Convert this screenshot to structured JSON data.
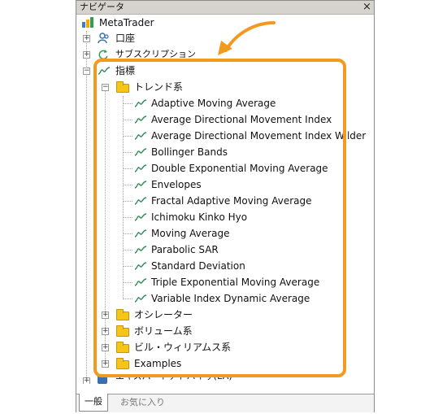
{
  "window": {
    "title": "ナビゲータ",
    "close_label": "×"
  },
  "tree": {
    "root": "MetaTrader",
    "account": "口座",
    "subscription": "サブスクリプション",
    "indicators": {
      "label": "指標",
      "trend": {
        "label": "トレンド系",
        "items": [
          "Adaptive Moving Average",
          "Average Directional Movement Index",
          "Average Directional Movement Index Wilder",
          "Bollinger Bands",
          "Double Exponential Moving Average",
          "Envelopes",
          "Fractal Adaptive Moving Average",
          "Ichimoku Kinko Hyo",
          "Moving Average",
          "Parabolic SAR",
          "Standard Deviation",
          "Triple Exponential Moving Average",
          "Variable Index Dynamic Average"
        ]
      },
      "folders": [
        "オシレーター",
        "ボリューム系",
        "ビル・ウィリアムス系",
        "Examples"
      ]
    },
    "experts": "エキスパートアドバイザ(EA)"
  },
  "tabs": {
    "general": "一般",
    "favorites": "お気に入り"
  },
  "colors": {
    "highlight": "#f29a20",
    "folder": "#f5c518",
    "indicator_icon": "#2e8b57"
  },
  "icons": {
    "root": "metatrader-logo-icon",
    "account": "users-icon",
    "subscription": "refresh-icon",
    "indicator": "wave-icon",
    "folder": "folder-icon"
  }
}
